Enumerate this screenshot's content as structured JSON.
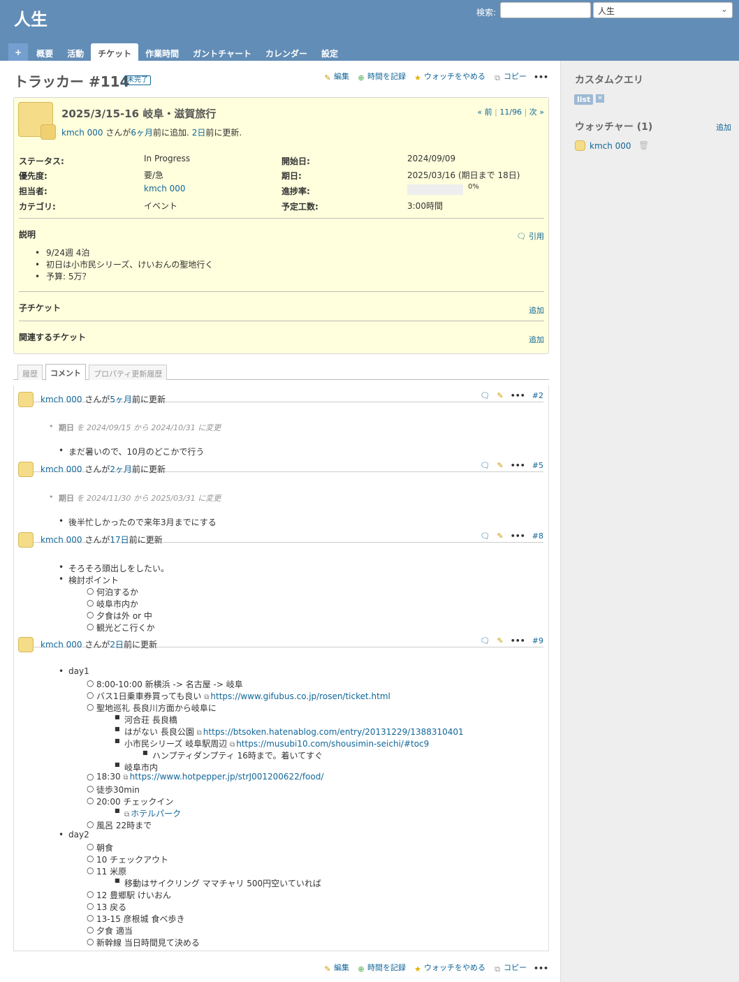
{
  "header": {
    "title": "人生",
    "search_label": "検索:",
    "project_select": "人生"
  },
  "menu": [
    "+",
    "概要",
    "活動",
    "チケット",
    "作業時間",
    "ガントチャート",
    "カレンダー",
    "設定"
  ],
  "issue": {
    "heading": "トラッカー #114",
    "status_badge": "未完了",
    "actions": {
      "edit": "編集",
      "log_time": "時間を記録",
      "unwatch": "ウォッチをやめる",
      "copy": "コピー",
      "more": "•••"
    },
    "subject": "2025/3/15-16 岐阜・滋賀旅行",
    "nav": {
      "prev": "« 前",
      "count": "11/96",
      "next": "次 »"
    },
    "author_line": {
      "author": "kmch 000",
      "t1": "さんが",
      "added": "6ヶ月",
      "t2": "前に追加.",
      "updated": "2日",
      "t3": "前に更新."
    },
    "attributes": {
      "status_label": "ステータス:",
      "status": "In Progress",
      "priority_label": "優先度:",
      "priority": "要/急",
      "assignee_label": "担当者:",
      "assignee": "kmch 000",
      "category_label": "カテゴリ:",
      "category": "イベント",
      "start_label": "開始日:",
      "start": "2024/09/09",
      "due_label": "期日:",
      "due": "2025/03/16 (期日まで 18日)",
      "progress_label": "進捗率:",
      "progress": "0%",
      "progress_fraction": 0,
      "estimate_label": "予定工数:",
      "estimate": "3:00時間"
    },
    "description_label": "説明",
    "quote": "引用",
    "description": [
      "9/24週 4泊",
      "初日は小市民シリーズ、けいおんの聖地行く",
      "予算: 5万？"
    ],
    "subtasks_label": "子チケット",
    "related_label": "関連するチケット",
    "add": "追加"
  },
  "tabs": [
    "履歴",
    "コメント",
    "プロパティ更新履歴"
  ],
  "journals": [
    {
      "author": "kmch 000",
      "t1": "さんが",
      "ago": "5ヶ月",
      "t2": "前に更新",
      "num": "#2",
      "detail": {
        "field": "期日",
        "a": "を",
        "from": "2024/09/15",
        "b": "から",
        "to": "2024/10/31",
        "c": "に変更"
      },
      "note": "まだ暑いので、10月のどこかで行う"
    },
    {
      "author": "kmch 000",
      "t1": "さんが",
      "ago": "2ヶ月",
      "t2": "前に更新",
      "num": "#5",
      "detail": {
        "field": "期日",
        "a": "を",
        "from": "2024/11/30",
        "b": "から",
        "to": "2025/03/31",
        "c": "に変更"
      },
      "note": "後半忙しかったので来年3月までにする"
    },
    {
      "author": "kmch 000",
      "t1": "さんが",
      "ago": "17日",
      "t2": "前に更新",
      "num": "#8",
      "notes": [
        "そろそろ頭出しをしたい。",
        "検討ポイント",
        "何泊するか",
        "岐阜市内か",
        "夕食は外 or 中",
        "観光どこ行くか"
      ]
    },
    {
      "author": "kmch 000",
      "t1": "さんが",
      "ago": "2日",
      "t2": "前に更新",
      "num": "#9",
      "lines": [
        "day1",
        "8:00-10:00 新横浜 -> 名古屋 -> 岐阜",
        "バス1日乗車券買っても良い",
        "https://www.gifubus.co.jp/rosen/ticket.html",
        "聖地巡礼 長良川方面から岐阜に",
        "河合荘 長良橋",
        "はがない 長良公園",
        "https://btsoken.hatenablog.com/entry/20131229/1388310401",
        "小市民シリーズ 岐阜駅周辺",
        "https://musubi10.com/shousimin-seichi/#toc9",
        "ハンプティダンプティ 16時まで。着いてすぐ",
        "岐阜市内",
        "18:30",
        "https://www.hotpepper.jp/strJ001200622/food/",
        "徒歩30min",
        "20:00 チェックイン",
        "ホテルパーク",
        "風呂 22時まで",
        "day2",
        "朝食",
        "10 チェックアウト",
        "11 米原",
        "移動はサイクリング ママチャリ 500円空いていれば",
        "12 豊郷駅 けいおん",
        "13 戻る",
        "13-15 彦根城 食べ歩き",
        "夕食 適当",
        "新幹線 当日時間見て決める"
      ]
    }
  ],
  "sidebar": {
    "queries_title": "カスタムクエリ",
    "query_tag": "list",
    "query_close": "✕",
    "watchers_title": "ウォッチャー (1)",
    "watchers_add": "追加",
    "watcher": "kmch 000"
  },
  "colors": {
    "header": "#628db6",
    "issue_bg": "#ffffdd",
    "link": "#169",
    "sidebar": "#eeeeee"
  }
}
